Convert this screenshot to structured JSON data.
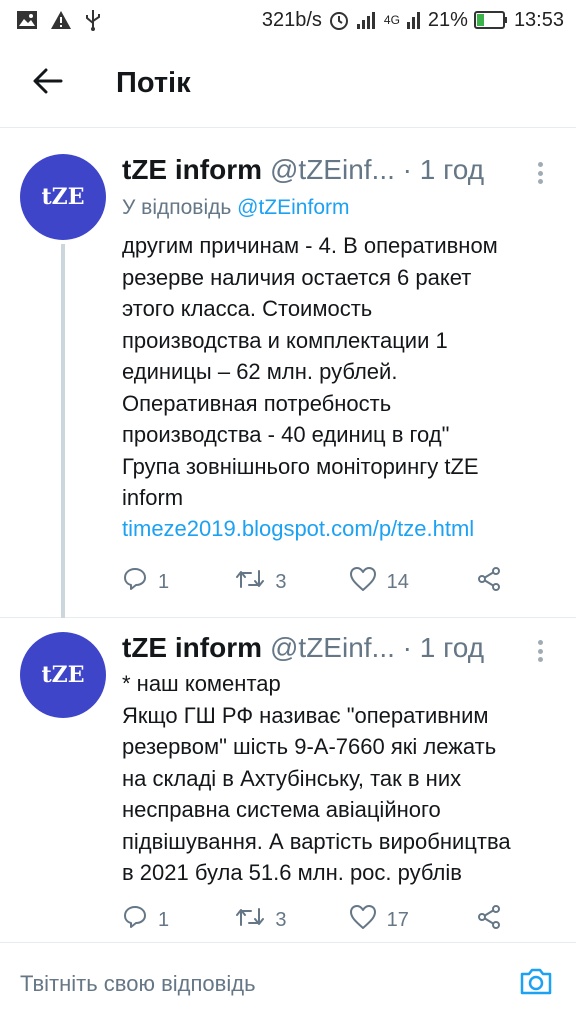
{
  "status_bar": {
    "speed": "321b/s",
    "network": "4G",
    "battery": "21%",
    "time": "13:53",
    "icons": [
      "image-icon",
      "warning-icon",
      "usb-icon",
      "alarm-icon",
      "signal-icon",
      "battery-icon"
    ]
  },
  "header": {
    "back_icon": "arrow-left-icon",
    "title": "Потік"
  },
  "tweets": [
    {
      "avatar_text": "tZE",
      "name": "tZE inform",
      "handle": "@tZEinf...",
      "separator": " · ",
      "time": "1 год",
      "reply_prefix": "У відповідь ",
      "reply_handle": "@tZEinform",
      "text": "другим причинам - 4. В оперативном\nрезерве наличия остается 6 ракет\nэтого класса. Стоимость\nпроизводства и комплектации 1\nединицы – 62 млн. рублей.\nОперативная потребность\nпроизводства - 40 единиц в год\"\nГрупа зовнішнього моніторингу tZE\ninform",
      "link": "timeze2019.blogspot.com/p/tze.html",
      "replies": "1",
      "retweets": "3",
      "likes": "14"
    },
    {
      "avatar_text": "tZE",
      "name": "tZE inform",
      "handle": "@tZEinf...",
      "separator": " · ",
      "time": "1 год",
      "text": "* наш коментар\nЯкщо ГШ РФ називає \"оперативним\nрезервом\" шість 9-А-7660 які лежать\nна складі в Ахтубінську, так в них\nнесправна система авіаційного\nпідвішування. А вартість виробництва\nв 2021 була 51.6 млн. рос. рублів",
      "replies": "1",
      "retweets": "3",
      "likes": "17"
    }
  ],
  "reply_bar": {
    "placeholder": "Твітніть свою відповідь",
    "camera_icon": "camera-icon"
  },
  "colors": {
    "accent": "#1da1f2",
    "avatar_bg": "#3e45c9",
    "muted": "#657786",
    "divider": "#e6ecf0"
  }
}
